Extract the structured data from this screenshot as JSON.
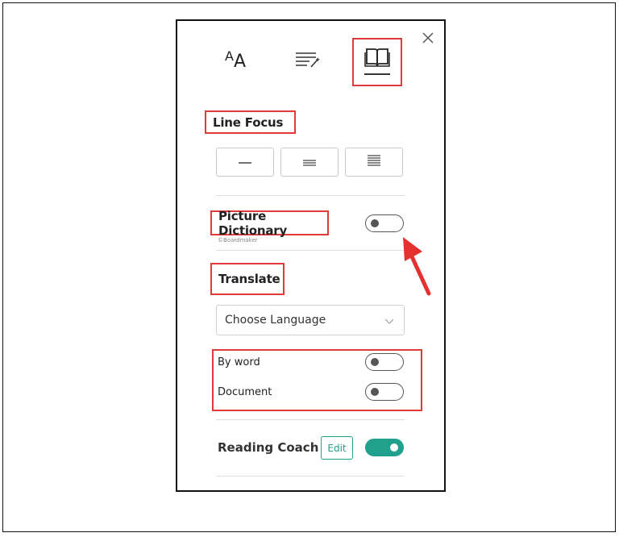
{
  "icons": {
    "close": "close-icon",
    "text_preferences": "text-size-icon",
    "grammar_options": "grammar-options-icon",
    "reading_preferences": "book-icon",
    "dropdown": "chevron-down-icon",
    "annotation": "red-arrow-icon"
  },
  "tabs": {
    "text_preferences_glyph_big": "A",
    "text_preferences_glyph_small": "A"
  },
  "line_focus": {
    "title": "Line Focus",
    "options": [
      "one-line-icon",
      "three-lines-icon",
      "five-lines-icon"
    ]
  },
  "picture_dictionary": {
    "title": "Picture Dictionary",
    "credit": "©Boardmaker",
    "enabled": false
  },
  "translate": {
    "title": "Translate",
    "language_select": "Choose Language",
    "by_word": {
      "label": "By word",
      "enabled": false
    },
    "document": {
      "label": "Document",
      "enabled": false
    }
  },
  "reading_coach": {
    "label": "Reading Coach",
    "edit_label": "Edit",
    "enabled": true
  },
  "colors": {
    "highlight_border": "#e03a3a",
    "accent": "#21a08d",
    "arrow": "#e53030"
  }
}
